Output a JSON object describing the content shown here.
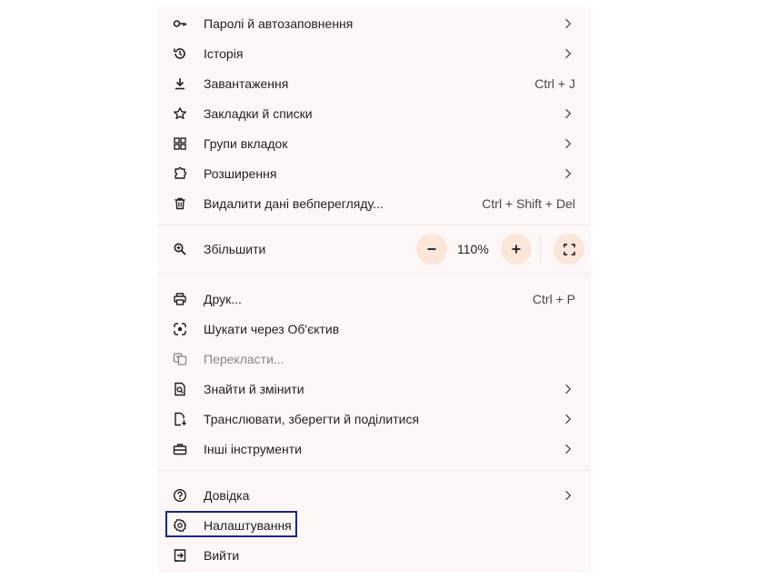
{
  "menu": {
    "items_top": [
      {
        "label": "Паролі й автозаповнення",
        "icon": "key-icon",
        "chevron": true
      },
      {
        "label": "Історія",
        "icon": "history-icon",
        "chevron": true
      },
      {
        "label": "Завантаження",
        "icon": "download-icon",
        "shortcut": "Ctrl + J"
      },
      {
        "label": "Закладки й списки",
        "icon": "star-icon",
        "chevron": true
      },
      {
        "label": "Групи вкладок",
        "icon": "tab-groups-icon",
        "chevron": true
      },
      {
        "label": "Розширення",
        "icon": "puzzle-icon",
        "chevron": true
      },
      {
        "label": "Видалити дані веб­перегляду...",
        "icon": "trash-icon",
        "shortcut": "Ctrl + Shift + Del"
      }
    ],
    "zoom": {
      "label": "Збільшити",
      "icon": "zoom-icon",
      "value": "110%",
      "minus": "−",
      "plus": "+"
    },
    "items_mid": [
      {
        "label": "Друк...",
        "icon": "print-icon",
        "shortcut": "Ctrl + P"
      },
      {
        "label": "Шукати через Об'єктив",
        "icon": "lens-icon"
      },
      {
        "label": "Перекласти...",
        "icon": "translate-icon",
        "disabled": true
      },
      {
        "label": "Знайти й змінити",
        "icon": "find-icon",
        "chevron": true
      },
      {
        "label": "Транслювати, зберегти й поділитися",
        "icon": "cast-save-icon",
        "chevron": true
      },
      {
        "label": "Інші інструменти",
        "icon": "toolbox-icon",
        "chevron": true
      }
    ],
    "items_bottom": [
      {
        "label": "Довідка",
        "icon": "help-icon",
        "chevron": true
      },
      {
        "label": "Налаштування",
        "icon": "settings-icon"
      },
      {
        "label": "Вийти",
        "icon": "exit-icon"
      }
    ]
  },
  "colors": {
    "menu_bg": "#fdf8f7",
    "zoom_button_bg": "#fbe6da",
    "highlight_border": "#1f2583"
  }
}
